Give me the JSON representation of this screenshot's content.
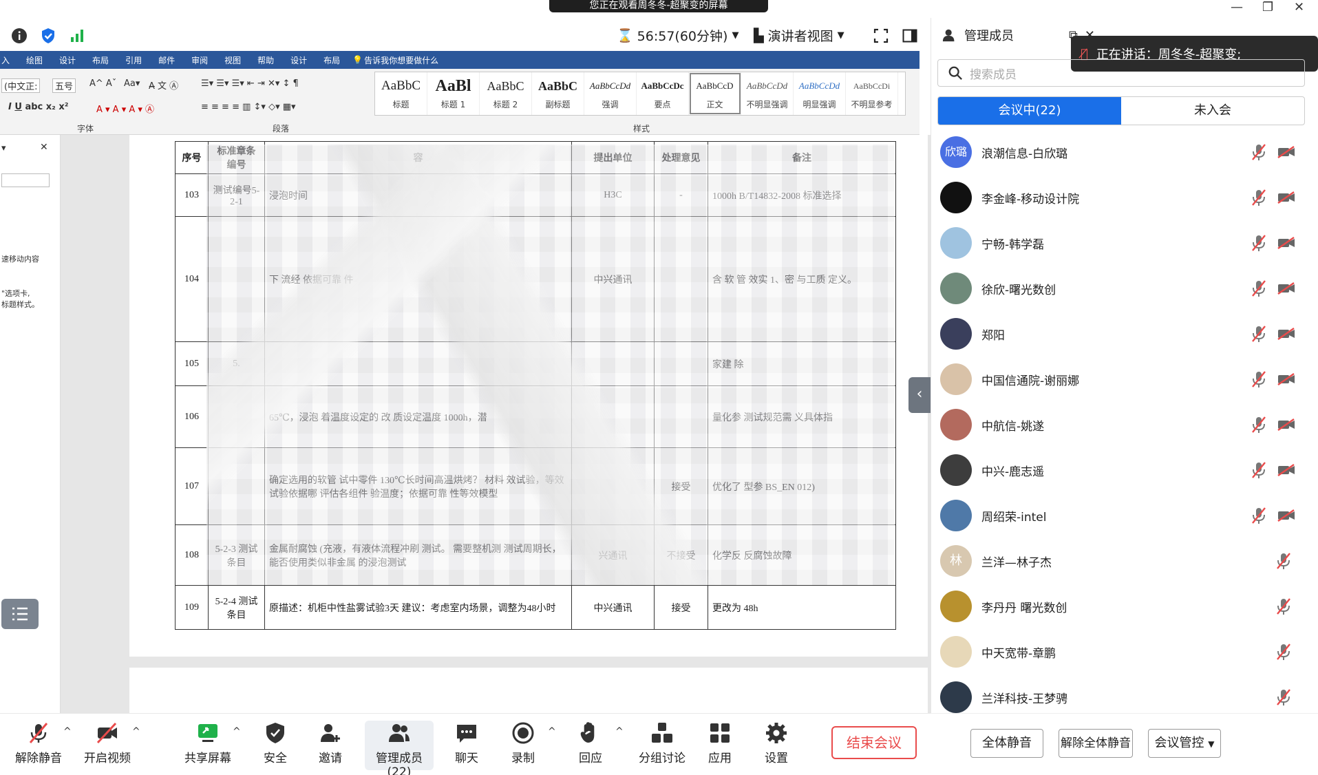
{
  "banner": {
    "text": "您正在观看周冬冬-超聚变的屏幕"
  },
  "topbar": {
    "timer": "56:57(60分钟)",
    "presenter_view": "演讲者视图"
  },
  "word": {
    "tabs": [
      "入",
      "绘图",
      "设计",
      "布局",
      "引用",
      "邮件",
      "审阅",
      "视图",
      "帮助",
      "设计",
      "布局",
      "告诉我你想要做什么"
    ],
    "font_name": "(中文正:",
    "font_size": "五号",
    "groups": {
      "font": "字体",
      "paragraph": "段落",
      "styles": "样式"
    },
    "styles": [
      {
        "sample": "AaBbC",
        "name": "标题"
      },
      {
        "sample": "AaBl",
        "name": "标题 1"
      },
      {
        "sample": "AaBbC",
        "name": "标题 2"
      },
      {
        "sample": "AaBbC",
        "name": "副标题"
      },
      {
        "sample": "AaBbCcDd",
        "name": "强调"
      },
      {
        "sample": "AaBbCcDc",
        "name": "要点"
      },
      {
        "sample": "AaBbCcD",
        "name": "正文"
      },
      {
        "sample": "AaBbCcDd",
        "name": "不明显强调"
      },
      {
        "sample": "AaBbCcDd",
        "name": "明显强调"
      },
      {
        "sample": "AaBbCcDi",
        "name": "不明显参考"
      }
    ],
    "nav_texts": [
      "速移动内容",
      "\"选项卡,",
      "标题样式。"
    ]
  },
  "table": {
    "headers": [
      "序号",
      "标准章条编号",
      "容",
      "提出单位",
      "处理意见",
      "备注"
    ],
    "rows": [
      {
        "no": "103",
        "clause": "测试编号5-2-1",
        "content": "浸泡时间",
        "unit": "H3C",
        "opinion": "-",
        "note": "1000h B/T14832-2008 标准选择"
      },
      {
        "no": "104",
        "clause": "",
        "content": "下 流经 依据可靠 件",
        "unit": "中兴通讯",
        "opinion": "",
        "note": "含 软 管 效实 1、密 与工质 定义。"
      },
      {
        "no": "105",
        "clause": "5.",
        "content": "",
        "unit": "",
        "opinion": "",
        "note": "家建 除"
      },
      {
        "no": "106",
        "clause": "",
        "content": "65℃，浸泡 着温度设定的 改 质设定温度 1000h，潜",
        "unit": "",
        "opinion": "",
        "note": "量化参 测试规范需 义具体指"
      },
      {
        "no": "107",
        "clause": "",
        "content": "确定选用的软管 试中零件 130℃长时间高温烘烤？ 材料 效试验，等效试验依据哪 评估各组件 验温度；依据可靠 性等效模型",
        "unit": "",
        "opinion": "接受",
        "note": "优化了 型参 BS_EN 012)"
      },
      {
        "no": "108",
        "clause": "5-2-3 测试条目",
        "content": "金属耐腐蚀 (充液，有液体流程冲刷 测试。 需要整机测 测试周期长，能否使用类似非金属 的浸泡测试",
        "unit": "兴通讯",
        "opinion": "不接受",
        "note": "化学反 反腐蚀故障"
      },
      {
        "no": "109",
        "clause": "5-2-4 测试条目",
        "content": "原描述：机柜中性盐雾试验3天 建议：考虑室内场景，调整为48小时",
        "unit": "中兴通讯",
        "opinion": "接受",
        "note": "更改为 48h"
      }
    ]
  },
  "panel": {
    "title": "管理成员",
    "speaking": "正在讲话：周冬冬-超聚变;",
    "search_placeholder": "搜索成员",
    "tab_in": "会议中(22)",
    "tab_out": "未入会",
    "members": [
      {
        "name": "浪潮信息-白欣璐",
        "avatar_text": "欣璐",
        "avatar_color": "#4a6fe3",
        "cam": true
      },
      {
        "name": "李金峰-移动设计院",
        "avatar_text": "",
        "avatar_color": "#111111",
        "cam": true
      },
      {
        "name": "宁畅-韩学磊",
        "avatar_text": "",
        "avatar_color": "#9fc3e0",
        "cam": true
      },
      {
        "name": "徐欣-曙光数创",
        "avatar_text": "",
        "avatar_color": "#6f8a7a",
        "cam": true
      },
      {
        "name": "郑阳",
        "avatar_text": "",
        "avatar_color": "#3a3f5c",
        "cam": true
      },
      {
        "name": "中国信通院-谢丽娜",
        "avatar_text": "",
        "avatar_color": "#d9c2a8",
        "cam": true
      },
      {
        "name": "中航信-姚遂",
        "avatar_text": "",
        "avatar_color": "#b36a5e",
        "cam": true
      },
      {
        "name": "中兴-鹿志遥",
        "avatar_text": "",
        "avatar_color": "#3d3d3d",
        "cam": true
      },
      {
        "name": "周绍荣-intel",
        "avatar_text": "",
        "avatar_color": "#4f79a8",
        "cam": true
      },
      {
        "name": "兰洋—林子杰",
        "avatar_text": "林",
        "avatar_color": "#d8c8b0",
        "cam": false
      },
      {
        "name": "李丹丹 曙光数创",
        "avatar_text": "",
        "avatar_color": "#b8912e",
        "cam": false
      },
      {
        "name": "中天宽带-章鹏",
        "avatar_text": "",
        "avatar_color": "#e7d8b8",
        "cam": false
      },
      {
        "name": "兰洋科技-王梦骋",
        "avatar_text": "",
        "avatar_color": "#2d3a4a",
        "cam": false
      }
    ],
    "btn_mute_all": "全体静音",
    "btn_unmute_all": "解除全体静音",
    "btn_control": "会议管控"
  },
  "toolbar": {
    "unmute": "解除静音",
    "video": "开启视频",
    "share": "共享屏幕",
    "security": "安全",
    "invite": "邀请",
    "members": "管理成员(22)",
    "chat": "聊天",
    "record": "录制",
    "react": "回应",
    "breakout": "分组讨论",
    "apps": "应用",
    "settings": "设置",
    "end": "结束会议"
  },
  "colors": {
    "accent": "#1a6fe8",
    "word_blue": "#2b579a",
    "danger": "#e94b4b",
    "signal": "#1fb14a"
  }
}
